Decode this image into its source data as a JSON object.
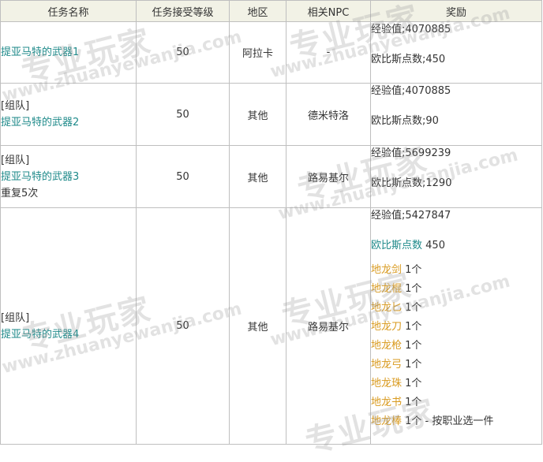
{
  "headers": [
    "任务名称",
    "任务接受等级",
    "地区",
    "相关NPC",
    "奖励"
  ],
  "rows": [
    {
      "name_lines": [
        {
          "text": "提亚马特的武器1",
          "color": "teal"
        }
      ],
      "level": "50",
      "region": "阿拉卡",
      "npc": "-",
      "exp": "经验值;4070885",
      "obs": "欧比斯点数;450"
    },
    {
      "name_lines": [
        {
          "text": "[组队]",
          "color": "black"
        },
        {
          "text": "提亚马特的武器2",
          "color": "teal"
        }
      ],
      "level": "50",
      "region": "其他",
      "npc": "德米特洛",
      "exp": "经验值;4070885",
      "obs": "欧比斯点数;90"
    },
    {
      "name_lines": [
        {
          "text": "[组队]",
          "color": "black"
        },
        {
          "text": "提亚马特的武器3",
          "color": "teal"
        },
        {
          "text": "重复5次",
          "color": "black"
        }
      ],
      "level": "50",
      "region": "其他",
      "npc": "路易基尔",
      "exp": "经验值;5699239",
      "obs": "欧比斯点数;1290"
    },
    {
      "name_lines": [
        {
          "text": "[组队]",
          "color": "black"
        },
        {
          "text": "提亚马特的武器4",
          "color": "teal"
        }
      ],
      "level": "50",
      "region": "其他",
      "npc": "路易基尔",
      "exp": "经验值;5427847",
      "obs_label": "欧比斯点数",
      "obs_value": " 450",
      "items": [
        {
          "name": "地龙剑",
          "qty": " 1个"
        },
        {
          "name": "地龙棍",
          "qty": " 1个"
        },
        {
          "name": "地龙匕",
          "qty": " 1个"
        },
        {
          "name": "地龙刀",
          "qty": " 1个"
        },
        {
          "name": "地龙枪",
          "qty": " 1个"
        },
        {
          "name": "地龙弓",
          "qty": " 1个"
        },
        {
          "name": "地龙珠",
          "qty": " 1个"
        },
        {
          "name": "地龙书",
          "qty": " 1个"
        },
        {
          "name": "地龙棒",
          "qty": " 1个 - 按职业选一件"
        }
      ]
    }
  ],
  "watermark": {
    "cn": "专业玩家",
    "en": "www.zhuanyewanjia.com"
  },
  "colors": {
    "teal": "#1f8a8a",
    "gold": "#d99a1e",
    "header_bg": "#f2f2e6",
    "border": "#bfbfbf"
  }
}
